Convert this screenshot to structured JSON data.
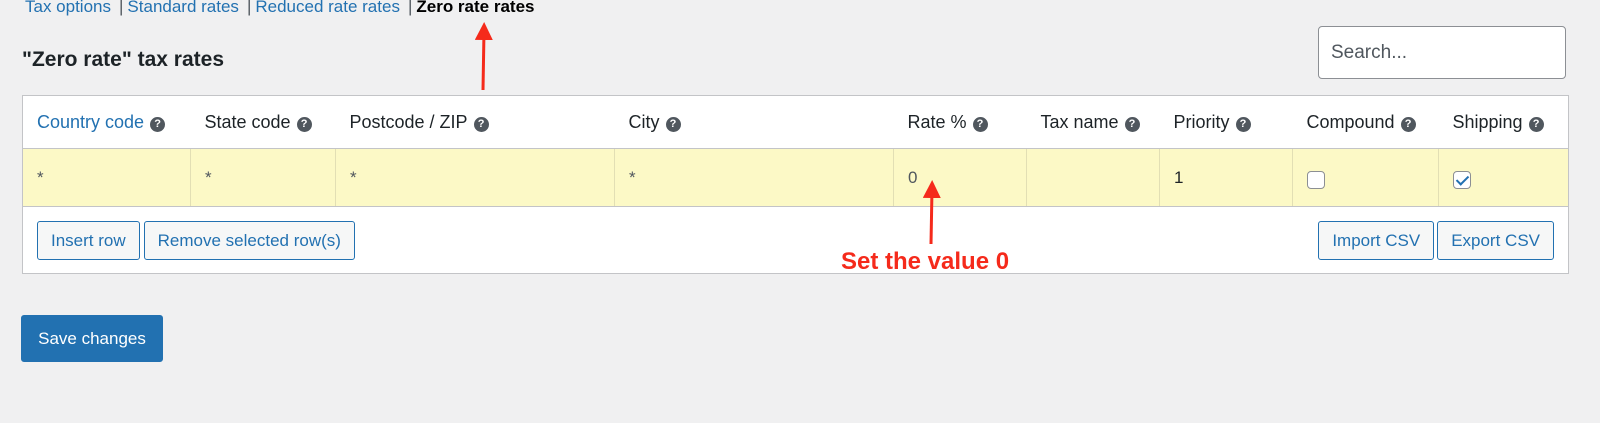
{
  "tabs": {
    "tax_options": "Tax options",
    "standard": "Standard rates",
    "reduced": "Reduced rate rates",
    "zero": "Zero rate rates",
    "separator": "|"
  },
  "page_title": "\"Zero rate\" tax rates",
  "search": {
    "placeholder": "Search..."
  },
  "table": {
    "columns": [
      "Country code",
      "State code",
      "Postcode / ZIP",
      "City",
      "Rate %",
      "Tax name",
      "Priority",
      "Compound",
      "Shipping"
    ],
    "help_glyph": "?",
    "row": {
      "country": "*",
      "state": "*",
      "postcode": "*",
      "city": "*",
      "rate": "0",
      "tax_name": "",
      "priority": "1",
      "compound": false,
      "shipping": true
    }
  },
  "buttons": {
    "insert_row": "Insert row",
    "remove_rows": "Remove selected row(s)",
    "import_csv": "Import CSV",
    "export_csv": "Export CSV",
    "save": "Save changes"
  },
  "annotation": {
    "text": "Set the value 0",
    "color": "#f52a1b"
  },
  "colors": {
    "accent": "#2271b1",
    "row_highlight": "#fcf9c6",
    "background": "#f0f0f1"
  }
}
